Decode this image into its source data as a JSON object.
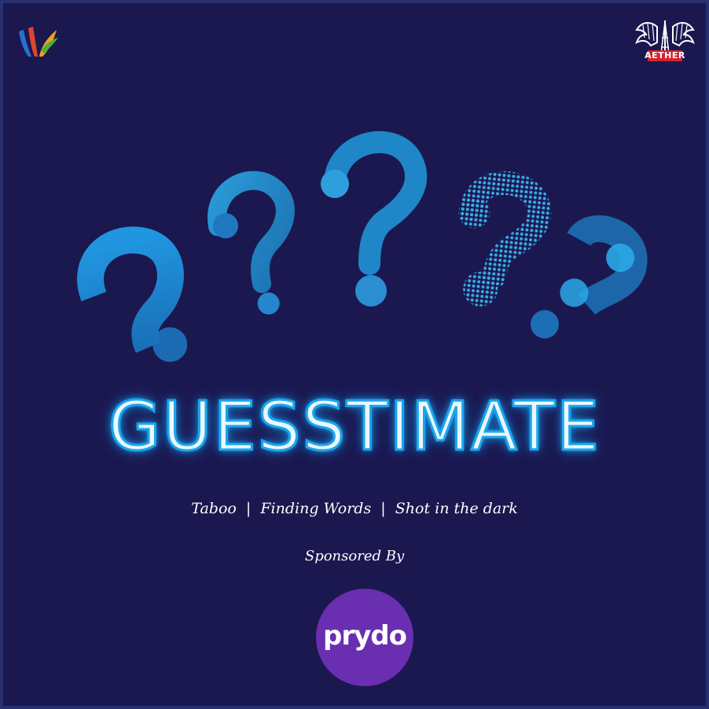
{
  "title": "GUESSTIMATE",
  "subtitle": "Taboo  |  Finding Words  |  Shot in the dark",
  "sponsored_label": "Sponsored By",
  "sponsor_name": "prydo",
  "logos": {
    "left_icon": "colorful-leaf-logo",
    "right_text": "AETHER"
  },
  "colors": {
    "background": "#1b1850",
    "accent_blue": "#1aa6ec",
    "sponsor_purple": "#6a2fb0"
  }
}
